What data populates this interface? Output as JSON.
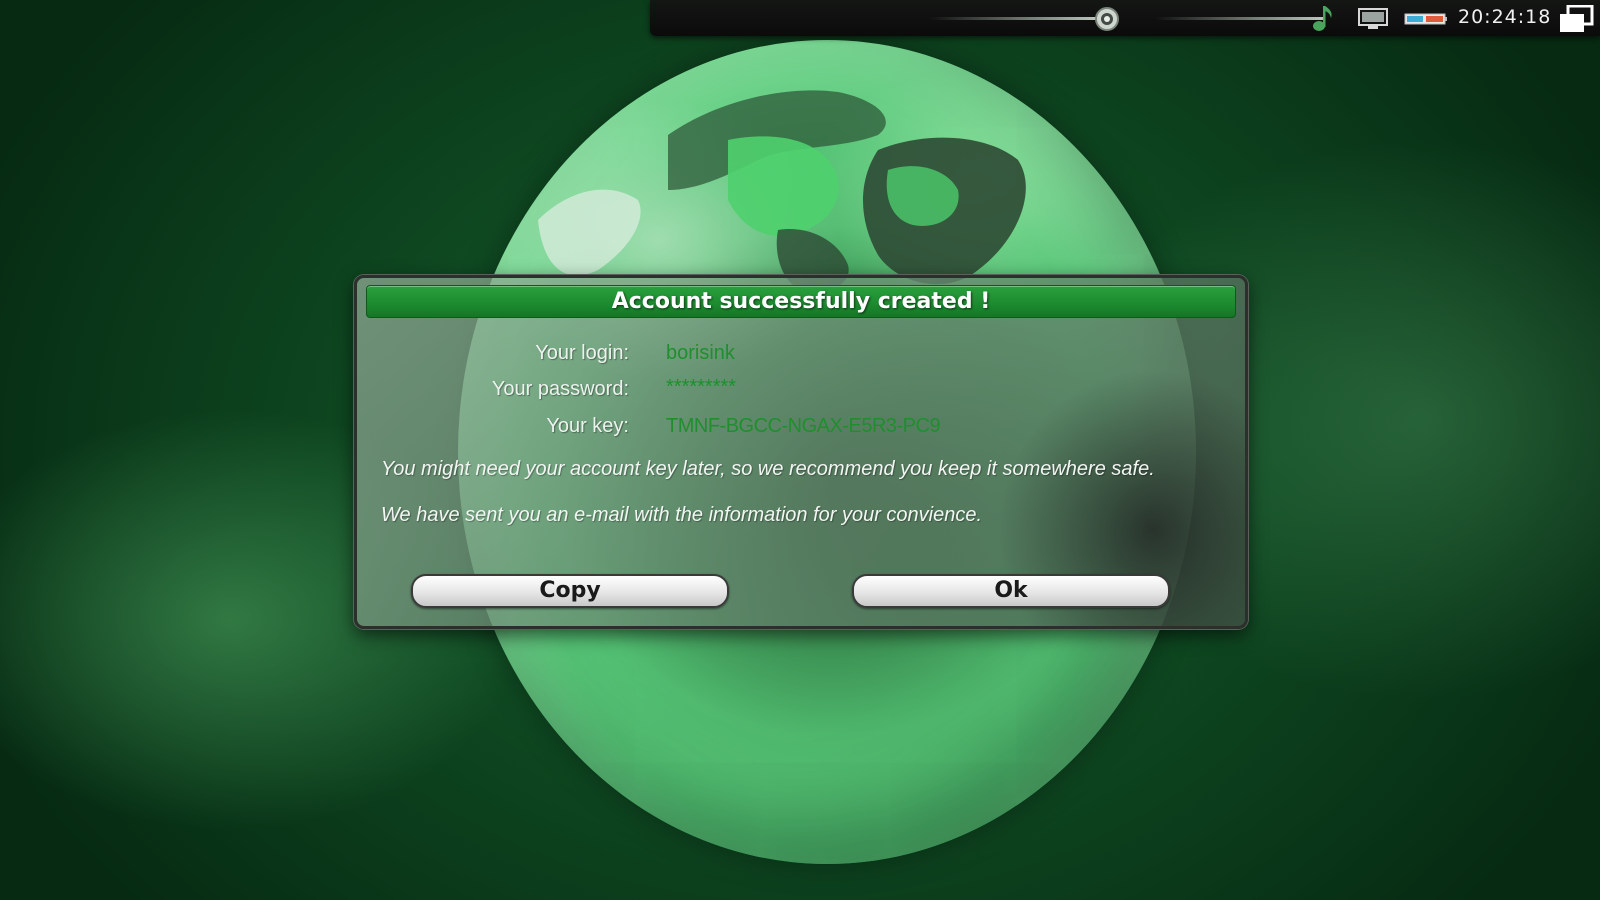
{
  "topbar": {
    "clock": "20:24:18",
    "icons": [
      "eye-icon",
      "music-note-icon",
      "monitor-icon",
      "battery-icon",
      "windows-icon"
    ]
  },
  "dialog": {
    "title": "Account successfully created !",
    "login_label": "Your login:",
    "login_value": "borisink",
    "password_label": "Your password:",
    "password_value": "*********",
    "key_label": "Your key:",
    "key_value": "TMNF-BGCC-NGAX-E5R3-PC9",
    "message_1": "You might need your account key later, so we recommend you keep it somewhere safe.",
    "message_2": "We have sent you an e-mail with the information for your convience.",
    "copy_label": "Copy",
    "ok_label": "Ok"
  },
  "colors": {
    "title_bar": "#1c8a2f",
    "value_text": "#1f8f2e",
    "background": "#0f4a22"
  }
}
